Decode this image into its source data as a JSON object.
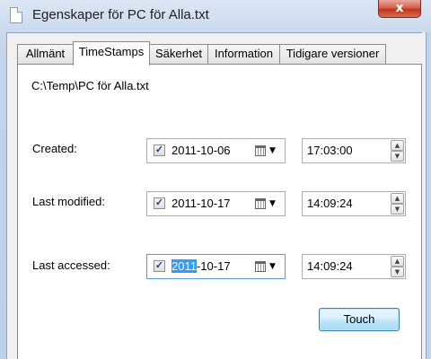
{
  "window": {
    "title": "Egenskaper för PC för Alla.txt",
    "close_glyph": "x"
  },
  "tabs": [
    {
      "label": "Allmänt",
      "active": false
    },
    {
      "label": "TimeStamps",
      "active": true
    },
    {
      "label": "Säkerhet",
      "active": false
    },
    {
      "label": "Information",
      "active": false
    },
    {
      "label": "Tidigare versioner",
      "active": false
    }
  ],
  "file_path": "C:\\Temp\\PC för Alla.txt",
  "rows": [
    {
      "label": "Created:",
      "checked": true,
      "date": "2011-10-06",
      "time": "17:03:00"
    },
    {
      "label": "Last modified:",
      "checked": true,
      "date": "2011-10-17",
      "time": "14:09:24"
    },
    {
      "label": "Last accessed:",
      "checked": true,
      "date_selected": "2011",
      "date_rest": "-10-17",
      "time": "14:09:24"
    }
  ],
  "check_glyph": "✓",
  "spin_up_glyph": "▲",
  "spin_down_glyph": "▼",
  "dropdown_glyph": "▼",
  "touch_label": "Touch"
}
